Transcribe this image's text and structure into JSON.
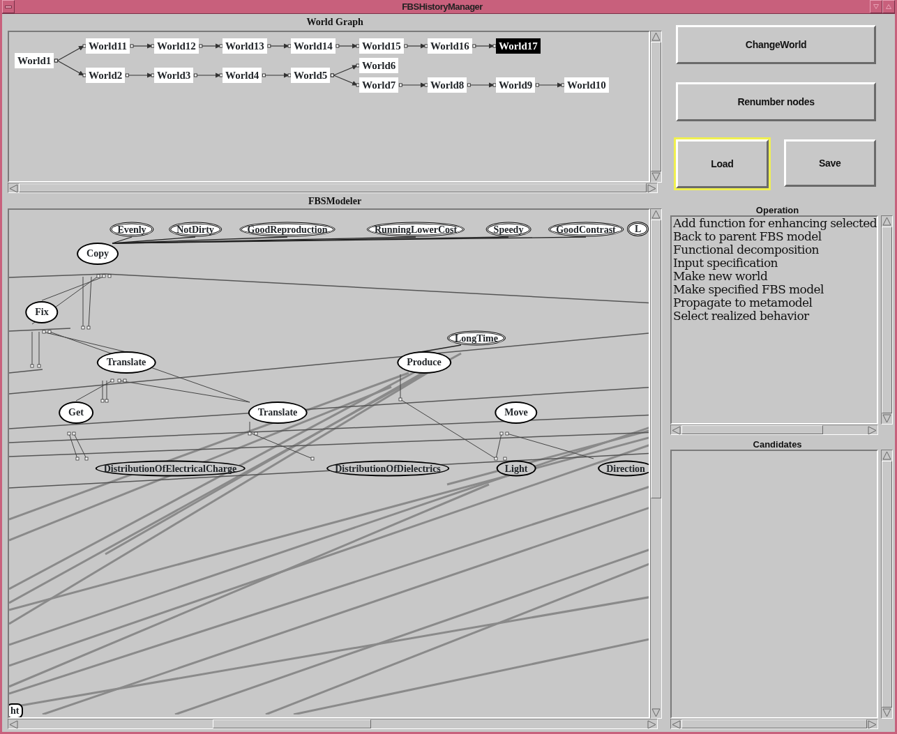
{
  "window": {
    "title": "FBSHistoryManager"
  },
  "world_graph": {
    "title": "World Graph",
    "root": {
      "label": "World1",
      "selected": false,
      "children": [
        {
          "label": "World11",
          "selected": false,
          "children": [
            {
              "label": "World12",
              "selected": false,
              "children": [
                {
                  "label": "World13",
                  "selected": false,
                  "children": [
                    {
                      "label": "World14",
                      "selected": false,
                      "children": [
                        {
                          "label": "World15",
                          "selected": false,
                          "children": [
                            {
                              "label": "World16",
                              "selected": false,
                              "children": [
                                {
                                  "label": "World17",
                                  "selected": true
                                }
                              ]
                            }
                          ]
                        }
                      ]
                    }
                  ]
                }
              ]
            }
          ]
        },
        {
          "label": "World2",
          "selected": false,
          "children": [
            {
              "label": "World3",
              "selected": false,
              "children": [
                {
                  "label": "World4",
                  "selected": false,
                  "children": [
                    {
                      "label": "World5",
                      "selected": false,
                      "children": [
                        {
                          "label": "World6",
                          "selected": false
                        },
                        {
                          "label": "World7",
                          "selected": false,
                          "children": [
                            {
                              "label": "World8",
                              "selected": false,
                              "children": [
                                {
                                  "label": "World9",
                                  "selected": false,
                                  "children": [
                                    {
                                      "label": "World10",
                                      "selected": false
                                    }
                                  ]
                                }
                              ]
                            }
                          ]
                        }
                      ]
                    }
                  ]
                }
              ]
            }
          ]
        }
      ]
    }
  },
  "buttons": [
    {
      "label": "ChangeWorld",
      "kind": "wide",
      "focused": false
    },
    {
      "label": "Renumber nodes",
      "kind": "wide",
      "focused": false
    },
    {
      "label": "Load",
      "kind": "half",
      "focused": true
    },
    {
      "label": "Save",
      "kind": "half",
      "focused": false
    }
  ],
  "modeler": {
    "title": "FBSModeler",
    "nodes": [
      {
        "label": "Evenly",
        "kind": "feature"
      },
      {
        "label": "NotDirty",
        "kind": "feature"
      },
      {
        "label": "GoodReproduction",
        "kind": "feature"
      },
      {
        "label": "RunningLowerCost",
        "kind": "feature"
      },
      {
        "label": "Speedy",
        "kind": "feature"
      },
      {
        "label": "GoodContrast",
        "kind": "feature"
      },
      {
        "label": "L",
        "kind": "feature"
      },
      {
        "label": "Copy",
        "kind": "function"
      },
      {
        "label": "Fix",
        "kind": "function"
      },
      {
        "label": "LongTime",
        "kind": "feature"
      },
      {
        "label": "Translate",
        "kind": "function"
      },
      {
        "label": "Produce",
        "kind": "function"
      },
      {
        "label": "Get",
        "kind": "function"
      },
      {
        "label": "Translate",
        "kind": "function"
      },
      {
        "label": "Move",
        "kind": "function"
      },
      {
        "label": "DistributionOfElectricalCharge",
        "kind": "entity"
      },
      {
        "label": "DistributionOfDielectrics",
        "kind": "entity"
      },
      {
        "label": "Light",
        "kind": "entity"
      },
      {
        "label": "Direction",
        "kind": "entity"
      },
      {
        "label": "ht",
        "kind": "box"
      }
    ]
  },
  "operation": {
    "title": "Operation",
    "items": [
      "Add function for enhancing selected",
      "Back to parent FBS model",
      "Functional decomposition",
      "Input specification",
      "Make new world",
      "Make specified FBS model",
      "Propagate to metamodel",
      "Select realized behavior"
    ]
  },
  "candidates": {
    "title": "Candidates"
  }
}
